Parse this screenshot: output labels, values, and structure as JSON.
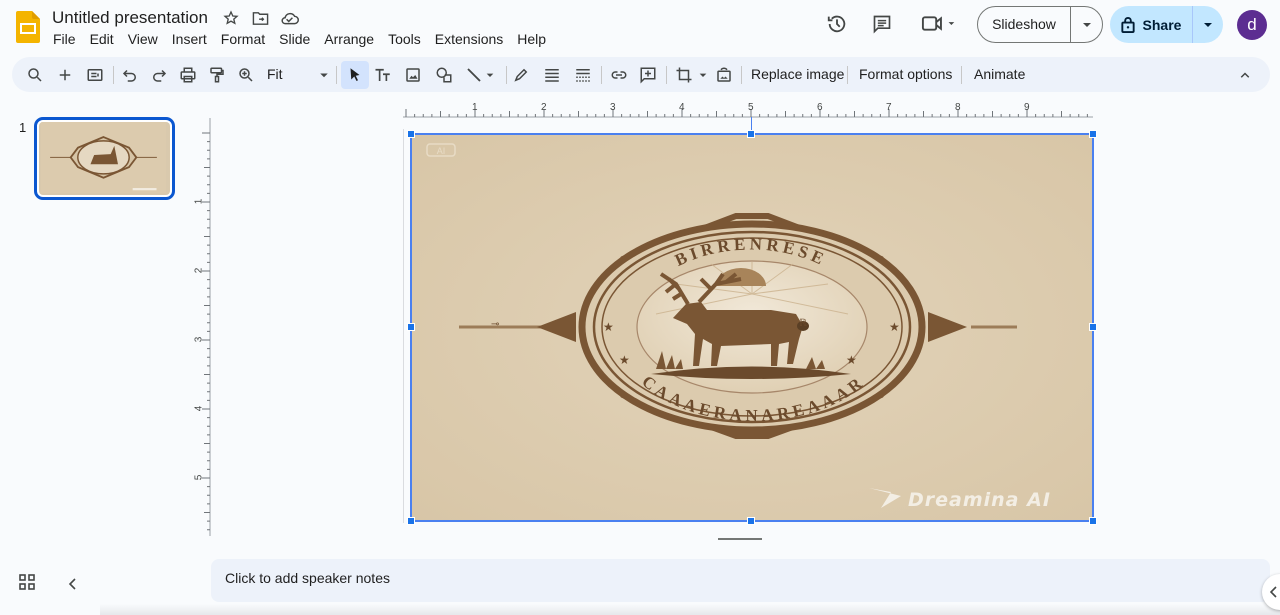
{
  "header": {
    "title": "Untitled presentation",
    "menu": [
      "File",
      "Edit",
      "View",
      "Insert",
      "Format",
      "Slide",
      "Arrange",
      "Tools",
      "Extensions",
      "Help"
    ],
    "slideshow_label": "Slideshow",
    "share_label": "Share",
    "avatar_initial": "d"
  },
  "toolbar": {
    "zoom_value": "Fit",
    "replace_image_label": "Replace image",
    "format_options_label": "Format options",
    "animate_label": "Animate"
  },
  "filmstrip": {
    "slides": [
      {
        "number": "1"
      }
    ]
  },
  "rulers": {
    "horizontal": [
      "1",
      "2",
      "3",
      "4",
      "5",
      "6",
      "7",
      "8",
      "9"
    ],
    "vertical": [
      "1",
      "2",
      "3",
      "4",
      "5"
    ]
  },
  "slide": {
    "image": {
      "top_text": "BIRRENRESE",
      "bottom_text": "CAAAERANAREAAAR",
      "ai_badge": "AI",
      "watermark": "Dreamina AI",
      "colors": {
        "background": "#dccbae",
        "ink": "#7a5634"
      }
    }
  },
  "notes": {
    "placeholder": "Click to add speaker notes"
  },
  "colors": {
    "accent": "#0b57d0",
    "share_bg": "#c2e7ff",
    "avatar_bg": "#5c2d91"
  }
}
